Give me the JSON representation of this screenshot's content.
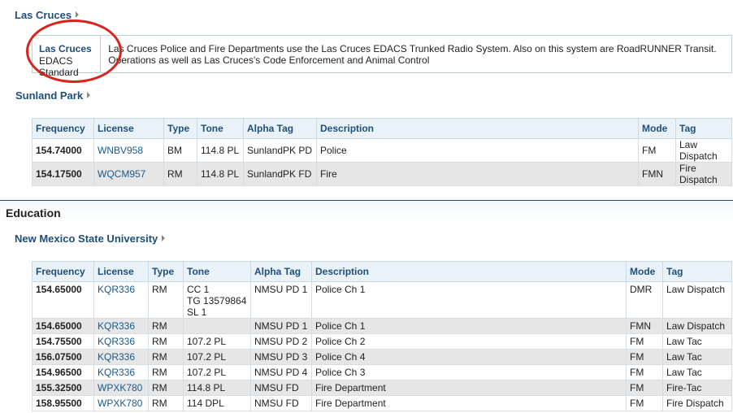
{
  "las_cruces": {
    "link": "Las Cruces",
    "system_name": "Las Cruces",
    "system_type": "EDACS Standard",
    "description": "Las Cruces Police and Fire Departments use the Las Cruces EDACS Trunked Radio System. Also on this system are RoadRUNNER Transit. Operations as well as Las Cruces's Code Enforcement and Animal Control"
  },
  "sunland": {
    "link": "Sunland Park",
    "headers": [
      "Frequency",
      "License",
      "Type",
      "Tone",
      "Alpha Tag",
      "Description",
      "Mode",
      "Tag"
    ],
    "rows": [
      [
        "154.74000",
        "WNBV958",
        "BM",
        "114.8 PL",
        "SunlandPK PD",
        "Police",
        "FM",
        "Law Dispatch"
      ],
      [
        "154.17500",
        "WQCM957",
        "RM",
        "114.8 PL",
        "SunlandPK FD",
        "Fire",
        "FMN",
        "Fire Dispatch"
      ]
    ]
  },
  "education": {
    "section_title": "Education",
    "link": "New Mexico State University",
    "headers": [
      "Frequency",
      "License",
      "Type",
      "Tone",
      "Alpha Tag",
      "Description",
      "Mode",
      "Tag"
    ],
    "rows": [
      [
        "154.65000",
        "KQR336",
        "RM",
        "CC 1|TG 13579864|SL 1",
        "NMSU PD 1",
        "Police Ch 1",
        "DMR",
        "Law Dispatch"
      ],
      [
        "154.65000",
        "KQR336",
        "RM",
        "",
        "NMSU PD 1",
        "Police Ch 1",
        "FMN",
        "Law Dispatch"
      ],
      [
        "154.75500",
        "KQR336",
        "RM",
        "107.2 PL",
        "NMSU PD 2",
        "Police Ch 2",
        "FM",
        "Law Tac"
      ],
      [
        "156.07500",
        "KQR336",
        "RM",
        "107.2 PL",
        "NMSU PD 3",
        "Police Ch 4",
        "FM",
        "Law Tac"
      ],
      [
        "154.96500",
        "KQR336",
        "RM",
        "107.2 PL",
        "NMSU PD 4",
        "Police Ch 3",
        "FM",
        "Law Tac"
      ],
      [
        "155.32500",
        "WPXK780",
        "RM",
        "114.8 PL",
        "NMSU FD",
        "Fire Department",
        "FM",
        "Fire-Tac"
      ],
      [
        "158.95500",
        "WPXK780",
        "RM",
        "114 DPL",
        "NMSU FD",
        "Fire Department",
        "FM",
        "Fire Dispatch"
      ]
    ]
  }
}
